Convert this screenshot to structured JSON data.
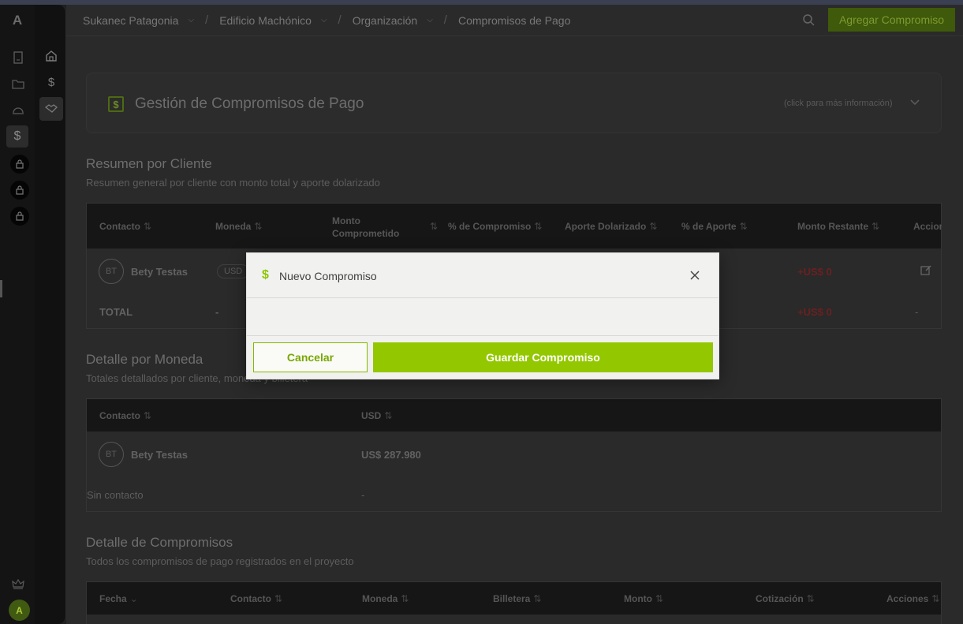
{
  "app": {
    "logo_letter": "A",
    "avatar_initial": "A"
  },
  "colors": {
    "accent": "#93c800",
    "danger": "#6b2020"
  },
  "rail": {
    "icons": [
      "building-icon",
      "folder-icon",
      "hardhat-icon",
      "dollar-icon",
      "lock-icon",
      "lock-icon",
      "lock-icon",
      "crown-icon"
    ]
  },
  "subnav": {
    "icons": [
      "home-icon",
      "dollar-icon",
      "handshake-icon"
    ]
  },
  "breadcrumb": {
    "items": [
      "Sukanec Patagonia",
      "Edificio Machónico",
      "Organización",
      "Compromisos de Pago"
    ],
    "separator": "/"
  },
  "header": {
    "add_button": "Agregar Compromiso"
  },
  "page_card": {
    "title": "Gestión de Compromisos de Pago",
    "hint": "(click para más información)"
  },
  "resumen": {
    "title": "Resumen por Cliente",
    "subtitle": "Resumen general por cliente con monto total y aporte dolarizado",
    "columns": [
      "Contacto",
      "Moneda",
      "Monto Comprometido",
      "% de Compromiso",
      "Aporte Dolarizado",
      "% de Aporte",
      "Monto Restante",
      "Acciones"
    ],
    "rows": [
      {
        "initials": "BT",
        "contacto": "Bety Testas",
        "moneda": "USD",
        "restante": "+US$ 0"
      }
    ],
    "total": {
      "label": "TOTAL",
      "moneda": "-",
      "restante": "+US$ 0",
      "acciones": "-"
    }
  },
  "detalle_moneda": {
    "title": "Detalle por Moneda",
    "subtitle": "Totales detallados por cliente, moneda y billetera",
    "columns": [
      "Contacto",
      "USD"
    ],
    "rows": [
      {
        "initials": "BT",
        "contacto": "Bety Testas",
        "usd": "US$ 287.980"
      },
      {
        "contacto": "Sin contacto",
        "usd": "-"
      }
    ]
  },
  "detalle_compromisos": {
    "title": "Detalle de Compromisos",
    "subtitle": "Todos los compromisos de pago registrados en el proyecto",
    "columns": [
      "Fecha",
      "Contacto",
      "Moneda",
      "Billetera",
      "Monto",
      "Cotización",
      "Acciones"
    ]
  },
  "modal": {
    "title": "Nuevo Compromiso",
    "cancel": "Cancelar",
    "save": "Guardar Compromiso"
  }
}
